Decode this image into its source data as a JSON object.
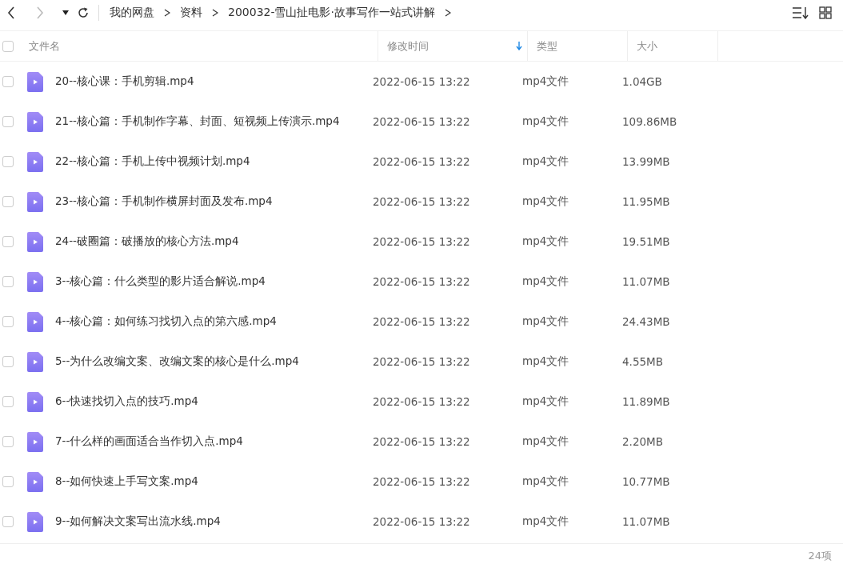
{
  "breadcrumb": [
    "我的网盘",
    "资料",
    "200032-雪山扯电影·故事写作一站式讲解"
  ],
  "all_selected": false,
  "columns": [
    {
      "label": "文件名",
      "sorted": false
    },
    {
      "label": "修改时间",
      "sorted": true
    },
    {
      "label": "类型",
      "sorted": false
    },
    {
      "label": "大小",
      "sorted": false
    }
  ],
  "rows": [
    {
      "name": "20--核心课：手机剪辑.mp4",
      "modified": "2022-06-15 13:22",
      "type": "mp4文件",
      "size": "1.04GB",
      "selected": false
    },
    {
      "name": "21--核心篇：手机制作字幕、封面、短视频上传演示.mp4",
      "modified": "2022-06-15 13:22",
      "type": "mp4文件",
      "size": "109.86MB",
      "selected": false
    },
    {
      "name": "22--核心篇：手机上传中视频计划.mp4",
      "modified": "2022-06-15 13:22",
      "type": "mp4文件",
      "size": "13.99MB",
      "selected": false
    },
    {
      "name": "23--核心篇：手机制作横屏封面及发布.mp4",
      "modified": "2022-06-15 13:22",
      "type": "mp4文件",
      "size": "11.95MB",
      "selected": false
    },
    {
      "name": "24--破圈篇：破播放的核心方法.mp4",
      "modified": "2022-06-15 13:22",
      "type": "mp4文件",
      "size": "19.51MB",
      "selected": false
    },
    {
      "name": "3--核心篇：什么类型的影片适合解说.mp4",
      "modified": "2022-06-15 13:22",
      "type": "mp4文件",
      "size": "11.07MB",
      "selected": false
    },
    {
      "name": "4--核心篇：如何练习找切入点的第六感.mp4",
      "modified": "2022-06-15 13:22",
      "type": "mp4文件",
      "size": "24.43MB",
      "selected": false
    },
    {
      "name": "5--为什么改编文案、改编文案的核心是什么.mp4",
      "modified": "2022-06-15 13:22",
      "type": "mp4文件",
      "size": "4.55MB",
      "selected": false
    },
    {
      "name": "6--快速找切入点的技巧.mp4",
      "modified": "2022-06-15 13:22",
      "type": "mp4文件",
      "size": "11.89MB",
      "selected": false
    },
    {
      "name": "7--什么样的画面适合当作切入点.mp4",
      "modified": "2022-06-15 13:22",
      "type": "mp4文件",
      "size": "2.20MB",
      "selected": false
    },
    {
      "name": "8--如何快速上手写文案.mp4",
      "modified": "2022-06-15 13:22",
      "type": "mp4文件",
      "size": "10.77MB",
      "selected": false
    },
    {
      "name": "9--如何解决文案写出流水线.mp4",
      "modified": "2022-06-15 13:22",
      "type": "mp4文件",
      "size": "11.07MB",
      "selected": false
    }
  ],
  "status": {
    "count": "24项"
  }
}
